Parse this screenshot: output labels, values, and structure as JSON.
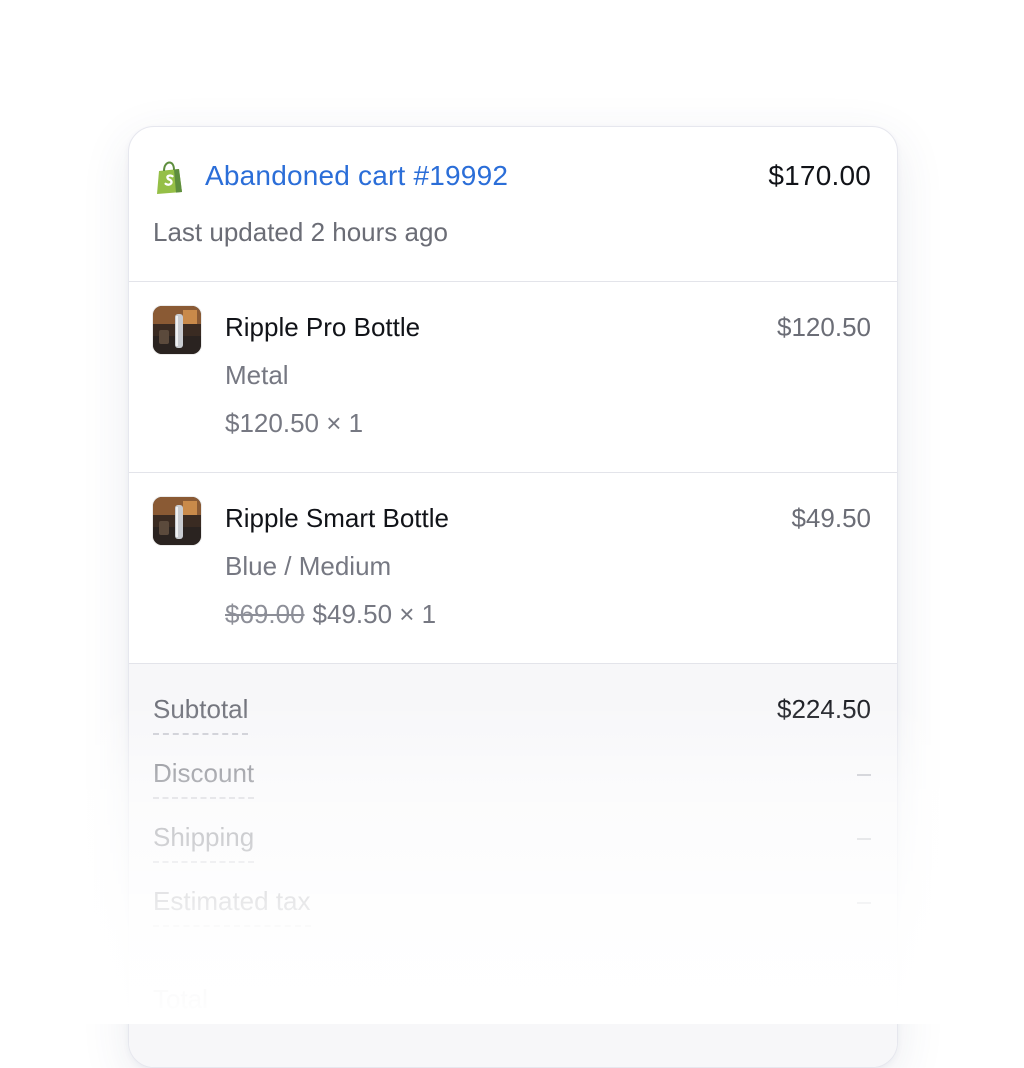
{
  "cart": {
    "title": "Abandoned cart #19992",
    "total": "$170.00",
    "updated": "Last updated 2 hours ago",
    "brand_icon": "shopify-bag-icon",
    "link_color": "#2b6ed8"
  },
  "items": [
    {
      "name": "Ripple Pro Bottle",
      "price": "$120.50",
      "variant": "Metal",
      "qty_line": "$120.50 × 1",
      "original_price": ""
    },
    {
      "name": "Ripple Smart Bottle",
      "price": "$49.50",
      "variant": "Blue / Medium",
      "original_price": "$69.00",
      "qty_line": "$49.50 × 1"
    }
  ],
  "summary": {
    "subtotal_label": "Subtotal",
    "subtotal_value": "$224.50",
    "discount_label": "Discount",
    "shipping_label": "Shipping",
    "tax_label": "Estimated tax",
    "total_label": "Total"
  }
}
